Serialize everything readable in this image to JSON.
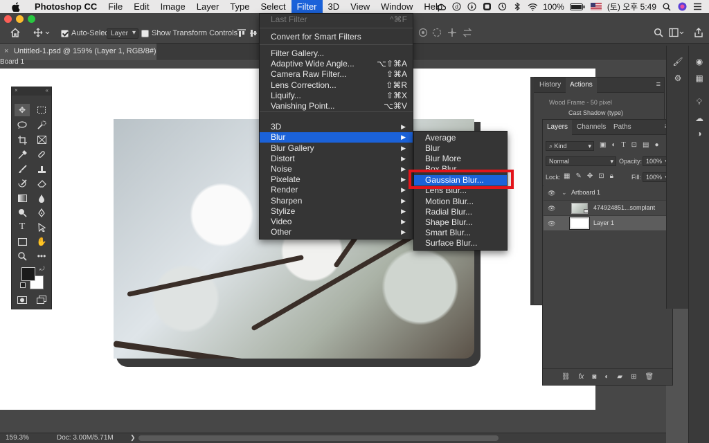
{
  "menubar": {
    "app_name": "Photoshop CC",
    "items": [
      "File",
      "Edit",
      "Image",
      "Layer",
      "Type",
      "Select",
      "Filter",
      "3D",
      "View",
      "Window",
      "Help"
    ],
    "active_item": "Filter",
    "battery": "100%",
    "clock": "(토) 오후 5:49"
  },
  "options_bar": {
    "auto_select_label": "Auto-Select:",
    "auto_select_value": "Layer",
    "transform_controls_label": "Show Transform Controls",
    "auto_select_checked": true,
    "transform_controls_checked": false
  },
  "document": {
    "tab_title": "Untitled-1.psd @ 159% (Layer 1, RGB/8#) *",
    "artboard_label": "Board 1"
  },
  "filter_menu": {
    "items": [
      {
        "label": "Last Filter",
        "shortcut": "^⌘F",
        "disabled": true
      },
      {
        "label": "Convert for Smart Filters"
      },
      {
        "label": "Filter Gallery..."
      },
      {
        "label": "Adaptive Wide Angle...",
        "shortcut": "⌥⇧⌘A"
      },
      {
        "label": "Camera Raw Filter...",
        "shortcut": "⇧⌘A"
      },
      {
        "label": "Lens Correction...",
        "shortcut": "⇧⌘R"
      },
      {
        "label": "Liquify...",
        "shortcut": "⇧⌘X"
      },
      {
        "label": "Vanishing Point...",
        "shortcut": "⌥⌘V"
      },
      {
        "label": "3D",
        "submenu": true
      },
      {
        "label": "Blur",
        "submenu": true,
        "highlighted": true
      },
      {
        "label": "Blur Gallery",
        "submenu": true
      },
      {
        "label": "Distort",
        "submenu": true
      },
      {
        "label": "Noise",
        "submenu": true
      },
      {
        "label": "Pixelate",
        "submenu": true
      },
      {
        "label": "Render",
        "submenu": true
      },
      {
        "label": "Sharpen",
        "submenu": true
      },
      {
        "label": "Stylize",
        "submenu": true
      },
      {
        "label": "Video",
        "submenu": true
      },
      {
        "label": "Other",
        "submenu": true
      }
    ]
  },
  "blur_submenu": {
    "items": [
      "Average",
      "Blur",
      "Blur More",
      "Box Blur...",
      "Gaussian Blur...",
      "Lens Blur...",
      "Motion Blur...",
      "Radial Blur...",
      "Shape Blur...",
      "Smart Blur...",
      "Surface Blur..."
    ],
    "highlighted": "Gaussian Blur..."
  },
  "history_panel": {
    "tabs": [
      "History",
      "Actions"
    ],
    "active_tab": "Actions",
    "rows": [
      "Wood Frame - 50 pixel",
      "Cast Shadow (type)"
    ]
  },
  "layers_panel": {
    "tabs": [
      "Layers",
      "Channels",
      "Paths"
    ],
    "active_tab": "Layers",
    "filter_kind": "Kind",
    "blend_mode": "Normal",
    "opacity_label": "Opacity:",
    "opacity_value": "100%",
    "lock_label": "Lock:",
    "fill_label": "Fill:",
    "fill_value": "100%",
    "layers": [
      {
        "name": "Artboard 1",
        "type": "group"
      },
      {
        "name": "474924851...somplant",
        "type": "smart"
      },
      {
        "name": "Layer 1",
        "type": "pixel",
        "selected": true
      }
    ]
  },
  "status_bar": {
    "zoom": "159.3%",
    "doc_size": "Doc: 3.00M/5.71M"
  },
  "colors": {
    "menu_highlight": "#1b62d9",
    "callout_red": "#e3141a"
  }
}
